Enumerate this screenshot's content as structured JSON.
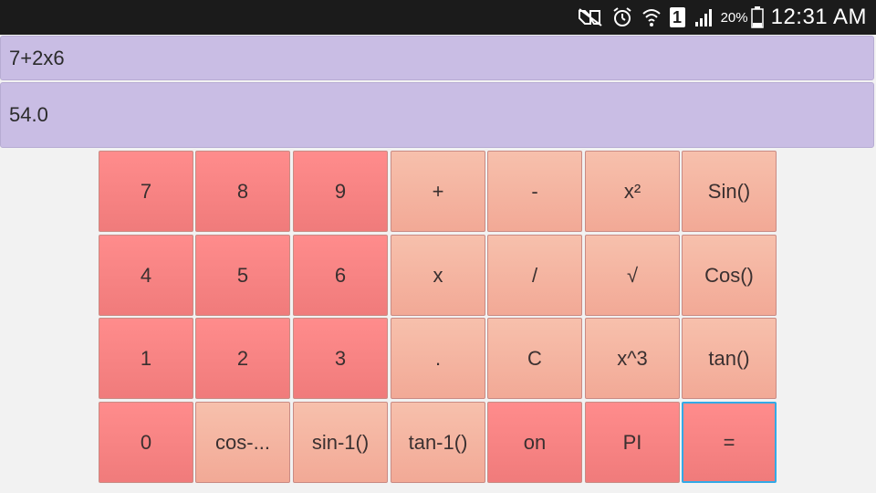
{
  "status_bar": {
    "icons": [
      "mute-icon",
      "alarm-icon",
      "wifi-icon",
      "sim-icon",
      "signal-icon",
      "battery-icon"
    ],
    "sim_slot": "1",
    "battery_percent": "20%",
    "time": "12:31 AM"
  },
  "display": {
    "expression": "7+2x6",
    "result": "54.0",
    "background": "#c9bde4"
  },
  "colors": {
    "key_red": "#f58585",
    "key_peach": "#f4b4a0",
    "focus": "#33a9e6"
  },
  "keypad": {
    "rows": [
      [
        "7",
        "8",
        "9",
        "+",
        "-",
        "x²",
        "Sin()"
      ],
      [
        "4",
        "5",
        "6",
        "x",
        "/",
        "√",
        "Cos()"
      ],
      [
        "1",
        "2",
        "3",
        ".",
        "C",
        "x^3",
        "tan()"
      ],
      [
        "0",
        "cos-...",
        "sin-1()",
        "tan-1()",
        "on",
        "PI",
        "="
      ]
    ],
    "focused_key": "="
  }
}
